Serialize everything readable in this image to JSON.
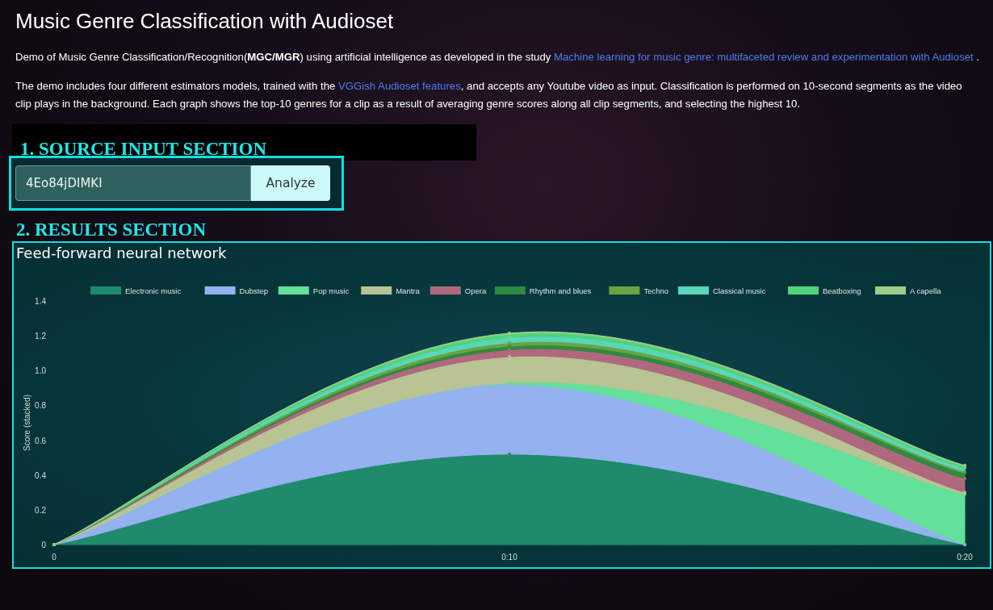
{
  "title": "Music Genre Classification with Audioset",
  "intro": "Demo of Music Genre Classification/Recognition(**MGC/MGR**) using artificial intelligence as developed in the study",
  "intro_link": "Machine learning for music genre: multifaceted review and experimentation with Audioset",
  "intro_end": ".",
  "demo_text_start": "The demo includes four different estimators models, trained with the",
  "demo_link": "VGGish Audioset features",
  "demo_text_end": ", and accepts any Youtube video as input. Classification is performed on 10-second segments as the video clip plays in the background. Each graph shows the top-10 genres for a clip as a result of averaging genre scores along all clip segments, and selecting the highest 10.",
  "source_section": {
    "label": "1. SOURCE INPUT SECTION",
    "input_value": "4Eo84jDIMKI",
    "button": "Analyze"
  },
  "results_section": {
    "label": "2. RESULTS SECTION",
    "panel_title": "Feed-forward neural network",
    "chart_data": {
      "type": "area",
      "stacked": true,
      "legend": "top",
      "ylabel": "Score (stacked)",
      "x": [
        "0",
        "0:10",
        "0:20"
      ],
      "ylim": [
        0,
        1.4
      ],
      "yticks": [
        0,
        0.2,
        0.4,
        0.6,
        0.8,
        {
          "value": 1,
          "label": "1.0"
        },
        1.2,
        1.4
      ],
      "series": [
        {
          "name": "Electronic music",
          "color": "#1f8a6c",
          "values": [
            0,
            0.52,
            0
          ]
        },
        {
          "name": "Dubstep",
          "color": "#94b2f0",
          "values": [
            0,
            0.4,
            0
          ]
        },
        {
          "name": "Pop music",
          "color": "#63e09a",
          "values": [
            0,
            0.01,
            0.29
          ]
        },
        {
          "name": "Mantra",
          "color": "#b8c493",
          "values": [
            0,
            0.15,
            0.01
          ]
        },
        {
          "name": "Opera",
          "color": "#b0687e",
          "values": [
            0,
            0.04,
            0.08
          ]
        },
        {
          "name": "Rhythm and blues",
          "color": "#2e8a3e",
          "values": [
            0,
            0.02,
            0.03
          ]
        },
        {
          "name": "Techno",
          "color": "#6aa342",
          "values": [
            0,
            0.02,
            0.01
          ]
        },
        {
          "name": "Classical music",
          "color": "#5ad6b8",
          "values": [
            0,
            0.03,
            0.02
          ]
        },
        {
          "name": "Beatboxing",
          "color": "#4fd479",
          "values": [
            0,
            0.02,
            0.01
          ]
        },
        {
          "name": "A capella",
          "color": "#9fcc8a",
          "values": [
            0,
            0.005,
            0.005
          ]
        }
      ]
    }
  }
}
